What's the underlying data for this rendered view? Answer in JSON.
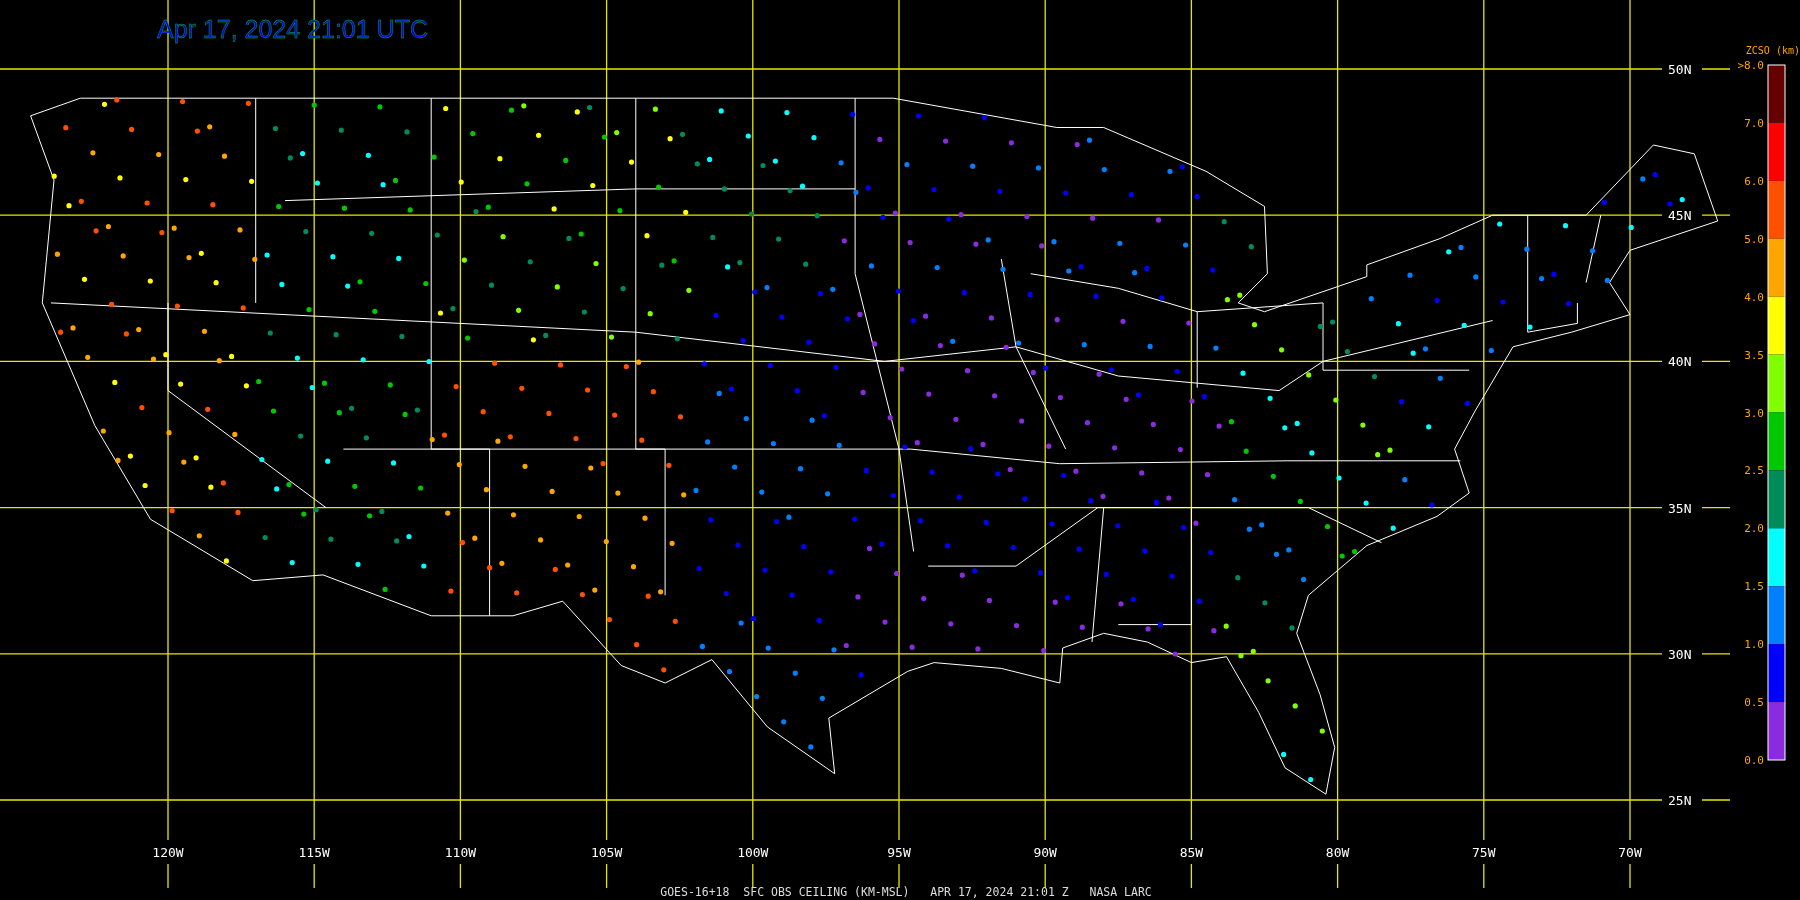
{
  "title": "Apr 17, 2024 21:01 UTC",
  "latitude_labels": [
    "50N",
    "45N",
    "40N",
    "35N",
    "30N",
    "25N"
  ],
  "longitude_labels": [
    "120W",
    "115W",
    "110W",
    "105W",
    "100W",
    "95W",
    "90W",
    "85W",
    "80W",
    "75W",
    "70W"
  ],
  "legend": {
    "title": "ZCSO (km)",
    "labels": [
      ">8.0",
      "7.0",
      "6.0",
      "5.0",
      "4.0",
      "3.5",
      "3.0",
      "2.5",
      "2.0",
      "1.5",
      "1.0",
      "0.5",
      "0.0"
    ],
    "bins": [
      {
        "color": "#660000"
      },
      {
        "color": "#ff0000"
      },
      {
        "color": "#ff5000"
      },
      {
        "color": "#ffa500"
      },
      {
        "color": "#ffff00"
      },
      {
        "color": "#80ff00"
      },
      {
        "color": "#00c800"
      },
      {
        "color": "#008c5a"
      },
      {
        "color": "#00ffff"
      },
      {
        "color": "#0080ff"
      },
      {
        "color": "#0000ff"
      },
      {
        "color": "#8a2be2"
      }
    ]
  },
  "caption": "GOES-16+18  SFC OBS CEILING (KM-MSL)   APR 17, 2024 21:01 Z   NASA LARC"
}
